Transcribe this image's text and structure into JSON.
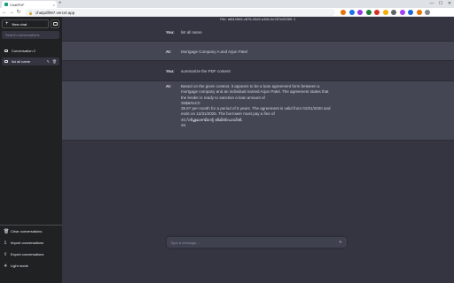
{
  "browser": {
    "tab_title": "ChatPDF",
    "tab_close": "×",
    "new_tab": "+",
    "url": "chatpdf097.vercel.app",
    "window_controls": [
      "—",
      "☐",
      "✕"
    ],
    "nav": [
      "←",
      "→",
      "↻"
    ],
    "extension_colors": [
      "#e8710a",
      "#1a73e8",
      "#9334e6",
      "#188038",
      "#d93025",
      "#f9ab00",
      "#5f6368",
      "#a142f4",
      "#1967d2",
      "#e37400",
      "#80868b"
    ]
  },
  "sidebar": {
    "new_chat_icon": "+",
    "new_chat_label": "New chat",
    "search_placeholder": "Search conversations",
    "conversations": [
      {
        "label": "Conversation 2",
        "active": false
      },
      {
        "label": "list all name",
        "active": true,
        "edit_icon": "✎",
        "delete_icon": "🗑"
      }
    ],
    "footer": [
      {
        "icon": "🗑",
        "label": "Clear conversations"
      },
      {
        "icon": "⇩",
        "label": "Import conversations"
      },
      {
        "icon": "⇧",
        "label": "Export conversations"
      },
      {
        "icon": "☀",
        "label": "Light mode"
      }
    ]
  },
  "main": {
    "file_name": "File: af6445b6-c876-40e5-a18e-6c787e81f3f6  ⇩",
    "messages": [
      {
        "role": "You:",
        "lines": [
          "list all name"
        ]
      },
      {
        "role": "AI:",
        "lines": [
          "Mortgage Company A and Arjun Patel"
        ]
      },
      {
        "role": "You:",
        "lines": [
          "summarize the PDF content"
        ]
      },
      {
        "role": "AI:",
        "lines": [
          "Based on the given context, it appears to be a loan agreement form between a",
          "mortgage company and an individual named Arjun Patel. The agreement states that",
          "the lender is ready to sanction a loan amount of",
          "35$&#x4;0",
          "39.67 per month for a period of 5 years. The agreement is valid from 01/01/2020 and",
          "ends on 12/31/2025. The borrower must pay a fine of",
          "40,/\\ൻഗൂമാണ്ടിന്റെ ൽമിൽവായിൽ.",
          "40."
        ]
      }
    ],
    "input_placeholder": "Type a message...",
    "send_icon": "➤"
  }
}
